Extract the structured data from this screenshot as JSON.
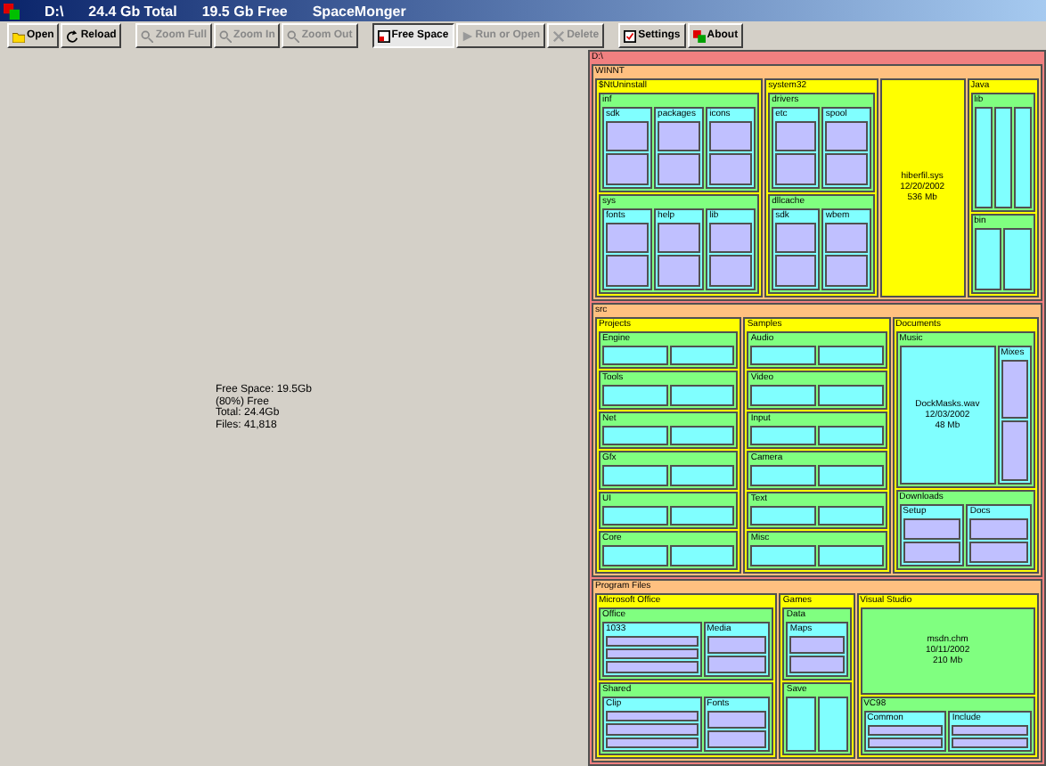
{
  "window": {
    "drive": "D:\\",
    "total": "24.4 Gb Total",
    "free": "19.5 Gb Free",
    "app": "SpaceMonger"
  },
  "toolbar": [
    {
      "label": "Open",
      "kind": "open",
      "disabled": false,
      "on": false
    },
    {
      "label": "Reload",
      "kind": "reload",
      "disabled": false,
      "on": false
    },
    {
      "label": "Zoom Full",
      "kind": "zoom",
      "disabled": true,
      "on": false
    },
    {
      "label": "Zoom In",
      "kind": "zoom",
      "disabled": true,
      "on": false
    },
    {
      "label": "Zoom Out",
      "kind": "zoom",
      "disabled": true,
      "on": false
    },
    {
      "label": "Free Space",
      "kind": "free",
      "disabled": false,
      "on": true
    },
    {
      "label": "Run or Open",
      "kind": "run",
      "disabled": true,
      "on": false
    },
    {
      "label": "Delete",
      "kind": "delete",
      "disabled": true,
      "on": false
    },
    {
      "label": "Settings",
      "kind": "settings",
      "disabled": false,
      "on": false
    },
    {
      "label": "About",
      "kind": "about",
      "disabled": false,
      "on": false
    }
  ],
  "free_space": {
    "lines": [
      "Free Space: 19.5Gb",
      "(80%) Free",
      "Total: 24.4Gb",
      "Files: 41,818"
    ]
  },
  "treemap": {
    "kind": "folder",
    "name": "D:\\",
    "children": [
      {
        "kind": "folder",
        "name": "WINNT",
        "children": [
          {
            "kind": "folder",
            "name": "$NtUninstall",
            "children": [
              {
                "kind": "folder",
                "name": "inf",
                "children": [
                  {
                    "kind": "folder",
                    "name": "sdk",
                    "children": [
                      {
                        "kind": "file"
                      },
                      {
                        "kind": "file"
                      }
                    ]
                  },
                  {
                    "kind": "folder",
                    "name": "packages",
                    "children": [
                      {
                        "kind": "file"
                      },
                      {
                        "kind": "file"
                      }
                    ]
                  },
                  {
                    "kind": "folder",
                    "name": "icons",
                    "children": [
                      {
                        "kind": "file"
                      },
                      {
                        "kind": "file"
                      }
                    ]
                  }
                ]
              },
              {
                "kind": "folder",
                "name": "sys",
                "children": [
                  {
                    "kind": "folder",
                    "name": "fonts",
                    "children": [
                      {
                        "kind": "file"
                      },
                      {
                        "kind": "file"
                      }
                    ]
                  },
                  {
                    "kind": "folder",
                    "name": "help",
                    "children": [
                      {
                        "kind": "file"
                      },
                      {
                        "kind": "file"
                      }
                    ]
                  },
                  {
                    "kind": "folder",
                    "name": "lib",
                    "children": [
                      {
                        "kind": "file"
                      },
                      {
                        "kind": "file"
                      }
                    ]
                  }
                ]
              }
            ]
          },
          {
            "kind": "folder",
            "name": "system32",
            "children": [
              {
                "kind": "folder",
                "name": "drivers",
                "children": [
                  {
                    "kind": "folder",
                    "name": "etc",
                    "children": [
                      {
                        "kind": "file"
                      },
                      {
                        "kind": "file"
                      }
                    ]
                  },
                  {
                    "kind": "folder",
                    "name": "spool",
                    "children": [
                      {
                        "kind": "file"
                      },
                      {
                        "kind": "file"
                      }
                    ]
                  }
                ]
              },
              {
                "kind": "folder",
                "name": "dllcache",
                "children": [
                  {
                    "kind": "folder",
                    "name": "sdk",
                    "children": [
                      {
                        "kind": "file"
                      },
                      {
                        "kind": "file"
                      }
                    ]
                  },
                  {
                    "kind": "folder",
                    "name": "wbem",
                    "children": [
                      {
                        "kind": "file"
                      },
                      {
                        "kind": "file"
                      }
                    ]
                  }
                ]
              }
            ]
          },
          {
            "kind": "file",
            "lines": [
              "hiberfil.sys",
              "12/20/2002",
              "536 Mb"
            ]
          },
          {
            "kind": "folder",
            "name": "Java",
            "children": [
              {
                "kind": "folder",
                "name": "lib",
                "children": [
                  {
                    "kind": "file"
                  },
                  {
                    "kind": "file"
                  },
                  {
                    "kind": "file"
                  }
                ]
              },
              {
                "kind": "folder",
                "name": "bin",
                "children": [
                  {
                    "kind": "file"
                  },
                  {
                    "kind": "file"
                  }
                ]
              }
            ]
          }
        ]
      },
      {
        "kind": "folder",
        "name": "src",
        "children": [
          {
            "kind": "folder",
            "name": "Projects",
            "children": [
              {
                "kind": "folder",
                "name": "Engine",
                "children": [
                  {
                    "kind": "file"
                  },
                  {
                    "kind": "file"
                  }
                ]
              },
              {
                "kind": "folder",
                "name": "Tools",
                "children": [
                  {
                    "kind": "file"
                  },
                  {
                    "kind": "file"
                  }
                ]
              },
              {
                "kind": "folder",
                "name": "Net",
                "children": [
                  {
                    "kind": "file"
                  },
                  {
                    "kind": "file"
                  }
                ]
              },
              {
                "kind": "folder",
                "name": "Gfx",
                "children": [
                  {
                    "kind": "file"
                  },
                  {
                    "kind": "file"
                  }
                ]
              },
              {
                "kind": "folder",
                "name": "UI",
                "children": [
                  {
                    "kind": "file"
                  },
                  {
                    "kind": "file"
                  }
                ]
              },
              {
                "kind": "folder",
                "name": "Core",
                "children": [
                  {
                    "kind": "file"
                  },
                  {
                    "kind": "file"
                  }
                ]
              }
            ]
          },
          {
            "kind": "folder",
            "name": "Samples",
            "children": [
              {
                "kind": "folder",
                "name": "Audio",
                "children": [
                  {
                    "kind": "file"
                  },
                  {
                    "kind": "file"
                  }
                ]
              },
              {
                "kind": "folder",
                "name": "Video",
                "children": [
                  {
                    "kind": "file"
                  },
                  {
                    "kind": "file"
                  }
                ]
              },
              {
                "kind": "folder",
                "name": "Input",
                "children": [
                  {
                    "kind": "file"
                  },
                  {
                    "kind": "file"
                  }
                ]
              },
              {
                "kind": "folder",
                "name": "Camera",
                "children": [
                  {
                    "kind": "file"
                  },
                  {
                    "kind": "file"
                  }
                ]
              },
              {
                "kind": "folder",
                "name": "Text",
                "children": [
                  {
                    "kind": "file"
                  },
                  {
                    "kind": "file"
                  }
                ]
              },
              {
                "kind": "folder",
                "name": "Misc",
                "children": [
                  {
                    "kind": "file"
                  },
                  {
                    "kind": "file"
                  }
                ]
              }
            ]
          },
          {
            "kind": "folder",
            "name": "Documents",
            "children": [
              {
                "kind": "folder",
                "name": "Music",
                "children": [
                  {
                    "kind": "file",
                    "lines": [
                      "DockMasks.wav",
                      "12/03/2002",
                      "48 Mb"
                    ]
                  },
                  {
                    "kind": "folder",
                    "name": "Mixes",
                    "children": [
                      {
                        "kind": "file"
                      },
                      {
                        "kind": "file"
                      }
                    ]
                  }
                ]
              },
              {
                "kind": "folder",
                "name": "Downloads",
                "children": [
                  {
                    "kind": "folder",
                    "name": "Setup",
                    "children": [
                      {
                        "kind": "file"
                      },
                      {
                        "kind": "file"
                      }
                    ]
                  },
                  {
                    "kind": "folder",
                    "name": "Docs",
                    "children": [
                      {
                        "kind": "file"
                      },
                      {
                        "kind": "file"
                      }
                    ]
                  }
                ]
              }
            ]
          }
        ]
      },
      {
        "kind": "folder",
        "name": "Program Files",
        "children": [
          {
            "kind": "folder",
            "name": "Microsoft Office",
            "children": [
              {
                "kind": "folder",
                "name": "Office",
                "children": [
                  {
                    "kind": "folder",
                    "name": "1033",
                    "children": [
                      {
                        "kind": "file"
                      },
                      {
                        "kind": "file"
                      },
                      {
                        "kind": "file"
                      }
                    ]
                  },
                  {
                    "kind": "folder",
                    "name": "Media",
                    "children": [
                      {
                        "kind": "file"
                      },
                      {
                        "kind": "file"
                      }
                    ]
                  }
                ]
              },
              {
                "kind": "folder",
                "name": "Shared",
                "children": [
                  {
                    "kind": "folder",
                    "name": "Clip",
                    "children": [
                      {
                        "kind": "file"
                      },
                      {
                        "kind": "file"
                      },
                      {
                        "kind": "file"
                      }
                    ]
                  },
                  {
                    "kind": "folder",
                    "name": "Fonts",
                    "children": [
                      {
                        "kind": "file"
                      },
                      {
                        "kind": "file"
                      }
                    ]
                  }
                ]
              }
            ]
          },
          {
            "kind": "folder",
            "name": "Games",
            "children": [
              {
                "kind": "folder",
                "name": "Data",
                "children": [
                  {
                    "kind": "folder",
                    "name": "Maps",
                    "children": [
                      {
                        "kind": "file"
                      },
                      {
                        "kind": "file"
                      }
                    ]
                  }
                ]
              },
              {
                "kind": "folder",
                "name": "Save",
                "children": [
                  {
                    "kind": "file"
                  },
                  {
                    "kind": "file"
                  }
                ]
              }
            ]
          },
          {
            "kind": "folder",
            "name": "Visual Studio",
            "children": [
              {
                "kind": "file",
                "lines": [
                  "msdn.chm",
                  "10/11/2002",
                  "210 Mb"
                ]
              },
              {
                "kind": "folder",
                "name": "VC98",
                "children": [
                  {
                    "kind": "folder",
                    "name": "Common",
                    "children": [
                      {
                        "kind": "file"
                      },
                      {
                        "kind": "file"
                      }
                    ]
                  },
                  {
                    "kind": "folder",
                    "name": "Include",
                    "children": [
                      {
                        "kind": "file"
                      },
                      {
                        "kind": "file"
                      }
                    ]
                  }
                ]
              }
            ]
          }
        ]
      }
    ]
  }
}
